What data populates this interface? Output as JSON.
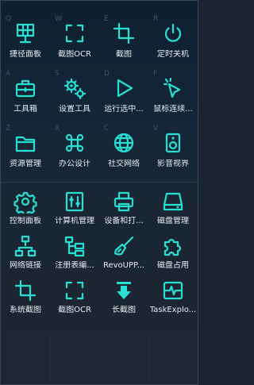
{
  "accent_color": "#27e0d3",
  "top_grid": [
    {
      "hotkey": "Q",
      "label": "捷径面板",
      "icon": "solar-panel-icon"
    },
    {
      "hotkey": "W",
      "label": "截图OCR",
      "icon": "screenshot-frame-icon"
    },
    {
      "hotkey": "E",
      "label": "截图",
      "icon": "crop-icon"
    },
    {
      "hotkey": "R",
      "label": "定时关机",
      "icon": "power-icon"
    },
    {
      "hotkey": "A",
      "label": "工具箱",
      "icon": "toolbox-icon"
    },
    {
      "hotkey": "S",
      "label": "设置工具",
      "icon": "gears-icon"
    },
    {
      "hotkey": "D",
      "label": "运行选中...",
      "icon": "play-icon"
    },
    {
      "hotkey": "F",
      "label": "鼠标连续...",
      "icon": "mouse-click-icon"
    },
    {
      "hotkey": "Z",
      "label": "资源管理",
      "icon": "folder-icon"
    },
    {
      "hotkey": "X",
      "label": "办公设计",
      "icon": "command-icon"
    },
    {
      "hotkey": "C",
      "label": "社交网络",
      "icon": "globe-icon"
    },
    {
      "hotkey": "V",
      "label": "影音视界",
      "icon": "speaker-icon"
    }
  ],
  "bottom_grid": [
    {
      "label": "控制面板",
      "icon": "gear-icon"
    },
    {
      "label": "计算机管理",
      "icon": "control-panel-icon"
    },
    {
      "label": "设备和打...",
      "icon": "printer-icon"
    },
    {
      "label": "磁盘管理",
      "icon": "disk-drive-icon"
    },
    {
      "label": "网络链接",
      "icon": "network-icon"
    },
    {
      "label": "注册表编...",
      "icon": "registry-tree-icon"
    },
    {
      "label": "RevoUPP...",
      "icon": "broom-icon"
    },
    {
      "label": "磁盘占用",
      "icon": "puzzle-icon"
    },
    {
      "label": "系统截图",
      "icon": "crop-icon"
    },
    {
      "label": "截图OCR",
      "icon": "screenshot-frame-icon"
    },
    {
      "label": "长截图",
      "icon": "download-arrow-icon"
    },
    {
      "label": "TaskExplo...",
      "icon": "pulse-monitor-icon"
    }
  ]
}
